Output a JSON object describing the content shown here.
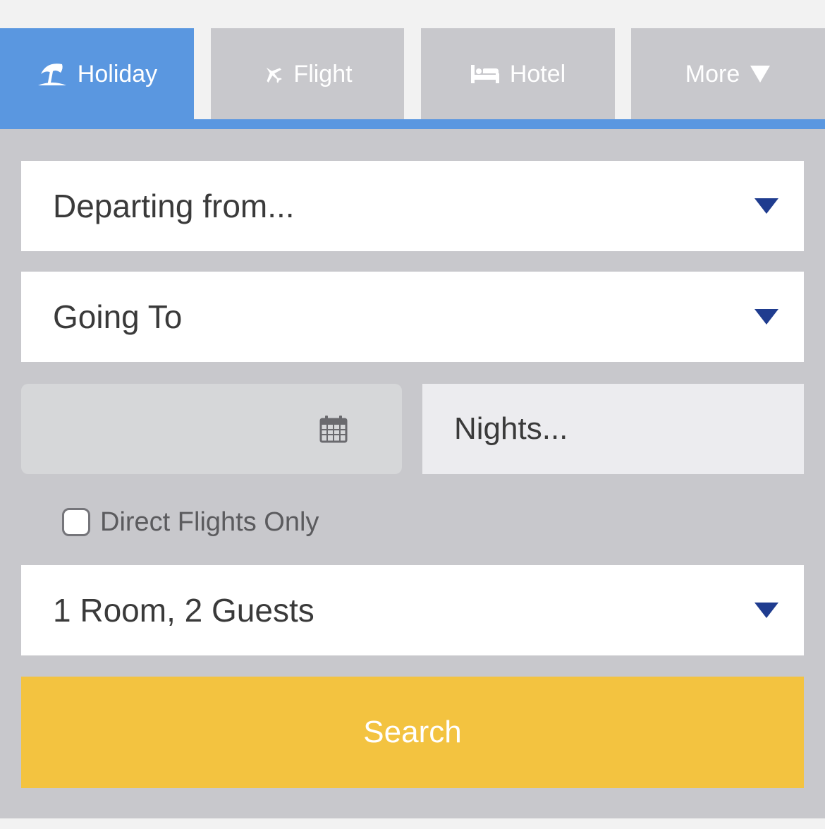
{
  "tabs": [
    {
      "label": "Holiday",
      "icon": "beach-umbrella-icon",
      "active": true
    },
    {
      "label": "Flight",
      "icon": "plane-icon",
      "active": false
    },
    {
      "label": "Hotel",
      "icon": "bed-icon",
      "active": false
    },
    {
      "label": "More",
      "icon": "caret-down-icon",
      "active": false
    }
  ],
  "form": {
    "departing_placeholder": "Departing from...",
    "going_to_placeholder": "Going To",
    "date_value": "",
    "nights_placeholder": "Nights...",
    "direct_flights_label": "Direct Flights Only",
    "direct_flights_checked": false,
    "rooms_guests": "1 Room, 2 Guests",
    "search_label": "Search"
  },
  "colors": {
    "accent": "#5a97e0",
    "tab_inactive": "#c8c8cc",
    "dropdown_arrow": "#1f3c8f",
    "search_button": "#f3c340"
  }
}
